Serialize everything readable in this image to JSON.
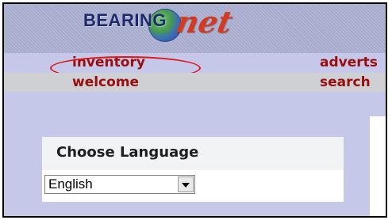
{
  "header": {
    "logo": {
      "bearing_text": "BEARING",
      "net_text": "net"
    }
  },
  "nav": {
    "row1": {
      "left": "inventory",
      "right": "adverts"
    },
    "row2": {
      "left": "welcome",
      "right": "search"
    }
  },
  "language": {
    "title": "Choose Language",
    "selected": "English"
  },
  "colors": {
    "nav_link": "#9b0d0d",
    "highlight": "#e01414",
    "background": "#c5c8e9"
  }
}
